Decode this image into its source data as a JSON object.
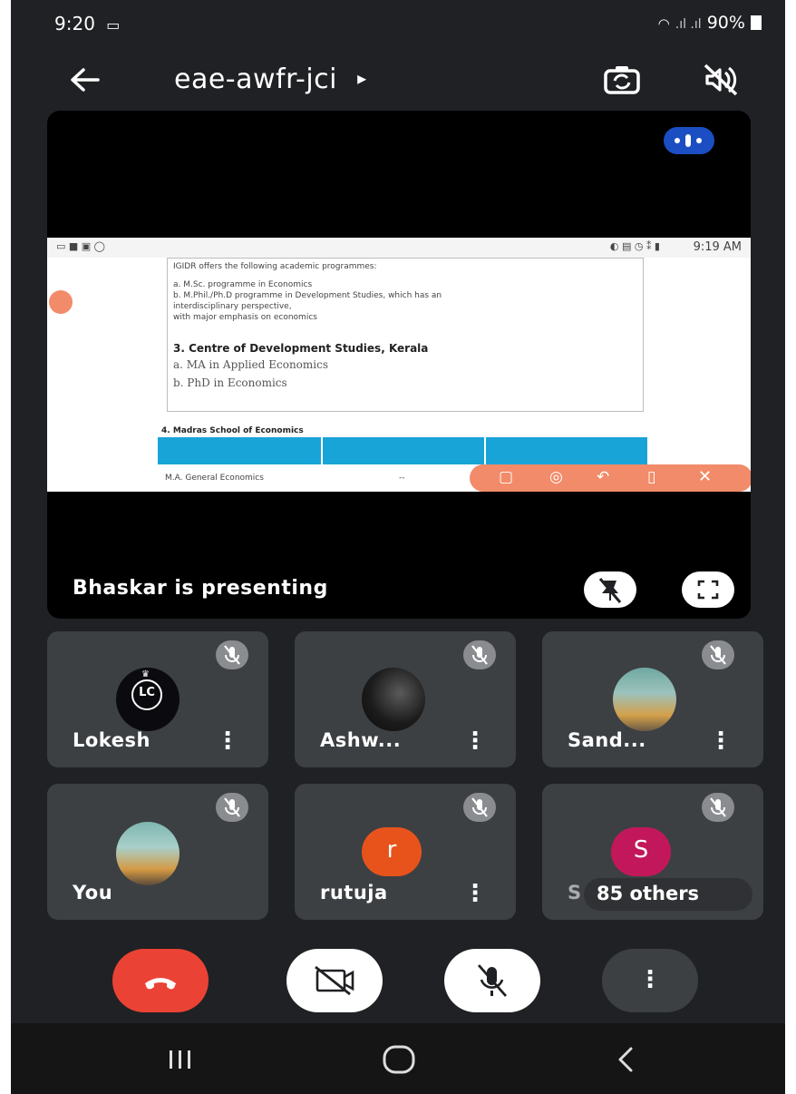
{
  "status_bar": {
    "time": "9:20",
    "battery": "90%"
  },
  "top_bar": {
    "meeting_code": "eae-awfr-jci",
    "code_chevron": "▸"
  },
  "colors": {
    "background": "#202124",
    "tile": "#3c4043",
    "end_call": "#ea4335",
    "accent_blue": "#1a4ec2",
    "avatar_orange": "#e8531b",
    "avatar_pink": "#c2185b"
  },
  "presentation": {
    "label": "Bhaskar is presenting",
    "shared_screen": {
      "status_time": "9:19 AM",
      "intro": "IGIDR offers the following academic programmes:",
      "programmes": [
        "a.   M.Sc. programme in Economics",
        "b.   M.Phil./Ph.D programme in Development Studies, which has an",
        "      interdisciplinary perspective,",
        "      with major emphasis on economics"
      ],
      "heading": "3. Centre of Development Studies, Kerala",
      "items": [
        "a. MA in Applied Economics",
        "b. PhD in Economics"
      ],
      "next_heading": "4. Madras School of Economics",
      "table_row": "M.A. General Economics",
      "table_cell": "--"
    }
  },
  "participants": [
    {
      "name": "Lokesh",
      "avatar": "logo",
      "logo_text": "LC"
    },
    {
      "name": "Ashw...",
      "avatar": "photo"
    },
    {
      "name": "Sand...",
      "avatar": "photo"
    },
    {
      "name": "You",
      "avatar": "photo"
    },
    {
      "name": "rutuja",
      "avatar": "letter",
      "initial": "r"
    },
    {
      "name": "S",
      "avatar": "letter",
      "initial": "S",
      "others_label": "85 others"
    }
  ],
  "controls": [
    "end-call",
    "camera-off",
    "mic-off",
    "more-options"
  ],
  "nav": [
    "recent-apps",
    "home",
    "back"
  ]
}
